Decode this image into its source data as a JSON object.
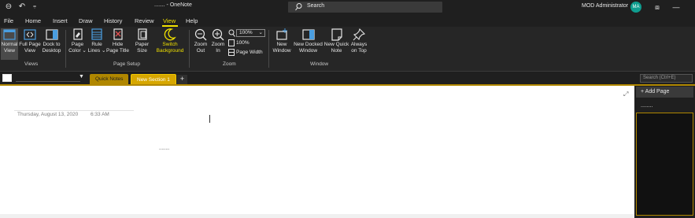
{
  "titlebar": {
    "title": "....... - OneNote",
    "search_label": "Search",
    "user_name": "MOD Administrator",
    "avatar_initials": "MA",
    "accent": "#0f9d8f"
  },
  "menu": {
    "tabs": [
      "File",
      "Home",
      "Insert",
      "Draw",
      "History",
      "Review",
      "View",
      "Help"
    ],
    "active": "View",
    "active_color": "#f0e000"
  },
  "ribbon": {
    "views": {
      "normal": [
        "Normal",
        "View"
      ],
      "full_page": [
        "Full Page",
        "View"
      ],
      "dock": [
        "Dock to",
        "Desktop"
      ],
      "label": "Views"
    },
    "page_setup": {
      "page_color": [
        "Page",
        "Color ⌄"
      ],
      "rule_lines": [
        "Rule",
        "Lines ⌄"
      ],
      "hide_title": [
        "Hide",
        "Page Title"
      ],
      "paper_size": [
        "Paper",
        "Size"
      ],
      "switch_bg": [
        "Switch",
        "Background"
      ],
      "label": "Page Setup"
    },
    "zoom": {
      "zoom_out": [
        "Zoom",
        "Out"
      ],
      "zoom_in": [
        "Zoom",
        "In"
      ],
      "zoom_value": "100%",
      "hundred": "100%",
      "page_width": "Page Width",
      "label": "Zoom"
    },
    "window": {
      "new_window": [
        "New",
        "Window"
      ],
      "new_docked": [
        "New Docked",
        "Window"
      ],
      "new_quick": [
        "New Quick",
        "Note"
      ],
      "always_top": [
        "Always",
        "on Top"
      ],
      "label": "Window"
    }
  },
  "notebook": {
    "sections": [
      "Quick Notes",
      "New Section 1"
    ],
    "add_section": "+",
    "search_placeholder": "Search (Ctrl+E)",
    "section_color": "#b08700"
  },
  "note": {
    "date": "Thursday, August 13, 2020",
    "time": "6:33 AM",
    "text": "........"
  },
  "pages": {
    "add_page": "+ Add Page",
    "items": [
      "........"
    ]
  }
}
